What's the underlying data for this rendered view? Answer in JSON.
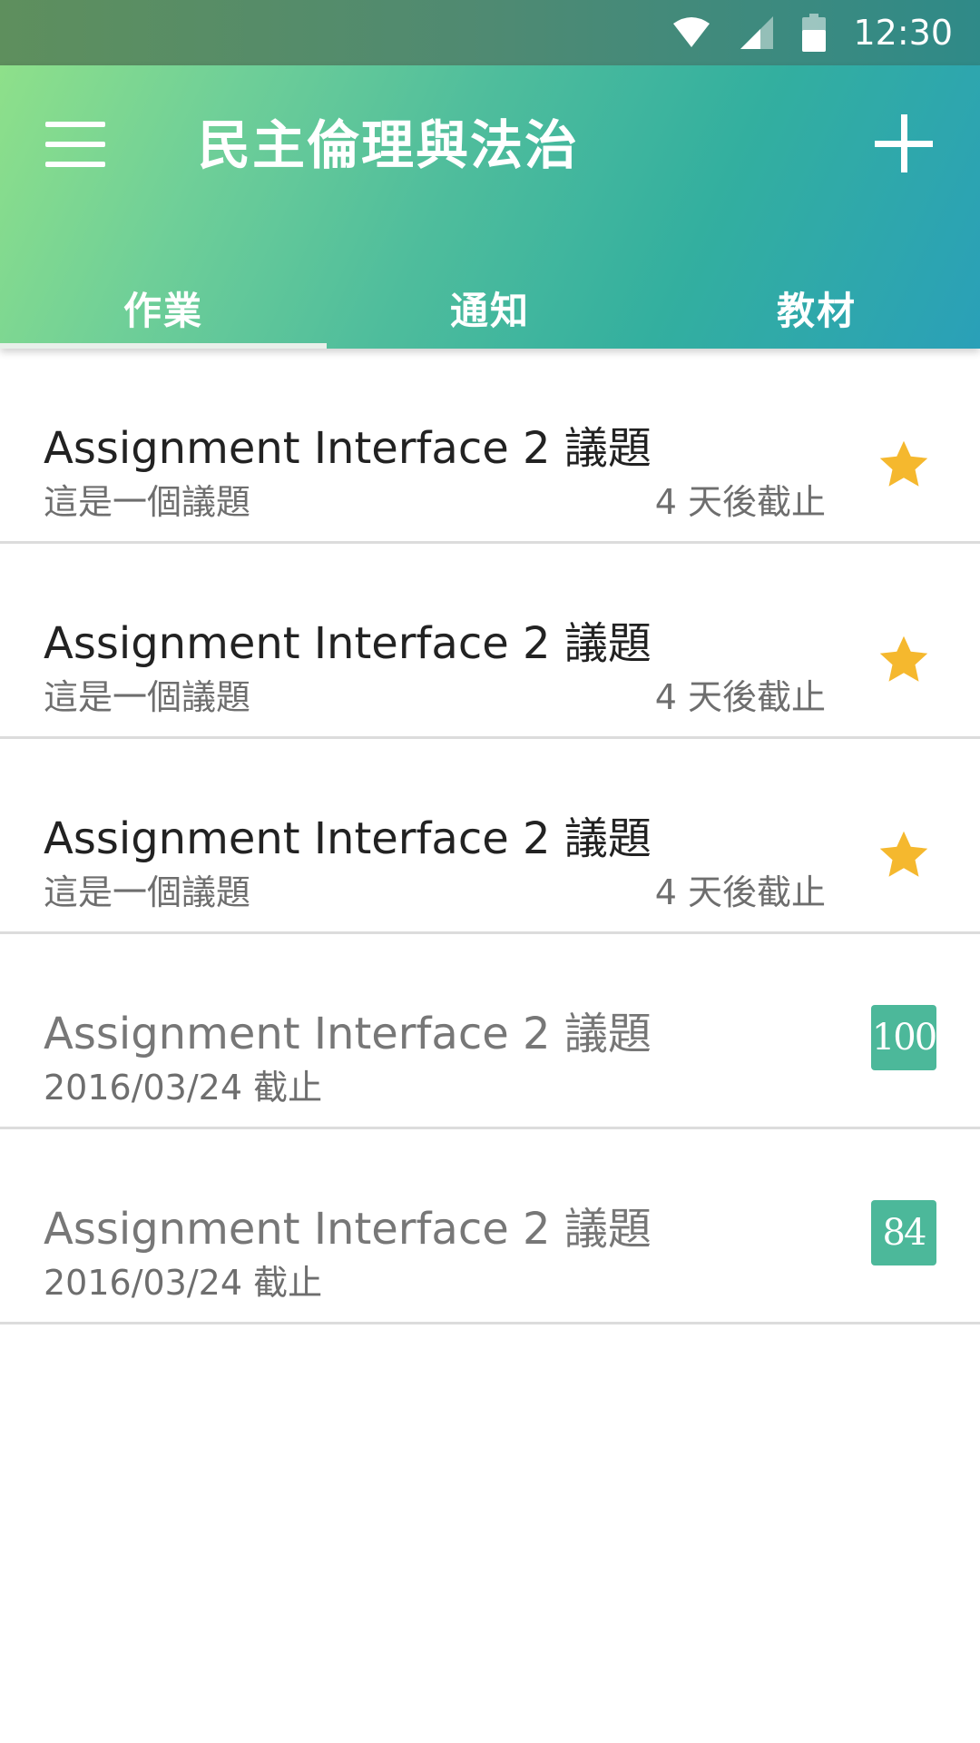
{
  "status_bar": {
    "time": "12:30",
    "icons": [
      "wifi-icon",
      "signal-icon",
      "battery-icon"
    ]
  },
  "header": {
    "title": "民主倫理與法治",
    "menu_icon": "menu-icon",
    "add_icon": "add-icon",
    "gradient": [
      "#8ee08a",
      "#4fbd9c",
      "#2aa0b8"
    ]
  },
  "tabs": [
    {
      "label": "作業",
      "active": true
    },
    {
      "label": "通知",
      "active": false
    },
    {
      "label": "教材",
      "active": false
    }
  ],
  "assignments": [
    {
      "title": "Assignment Interface 2 議題",
      "subtitle": "這是一個議題",
      "due": "4 天後截止",
      "status": "pending",
      "icon": "star-icon"
    },
    {
      "title": "Assignment Interface 2 議題",
      "subtitle": "這是一個議題",
      "due": "4 天後截止",
      "status": "pending",
      "icon": "star-icon"
    },
    {
      "title": "Assignment Interface 2 議題",
      "subtitle": "這是一個議題",
      "due": "4 天後截止",
      "status": "pending",
      "icon": "star-icon"
    },
    {
      "title": "Assignment Interface 2 議題",
      "subtitle": "2016/03/24 截止",
      "status": "graded",
      "score": "100"
    },
    {
      "title": "Assignment Interface 2 議題",
      "subtitle": "2016/03/24 截止",
      "status": "graded",
      "score": "84"
    }
  ],
  "colors": {
    "star": "#f5b82e",
    "score_badge": "#4cb89a",
    "divider": "#dcdcdc"
  }
}
